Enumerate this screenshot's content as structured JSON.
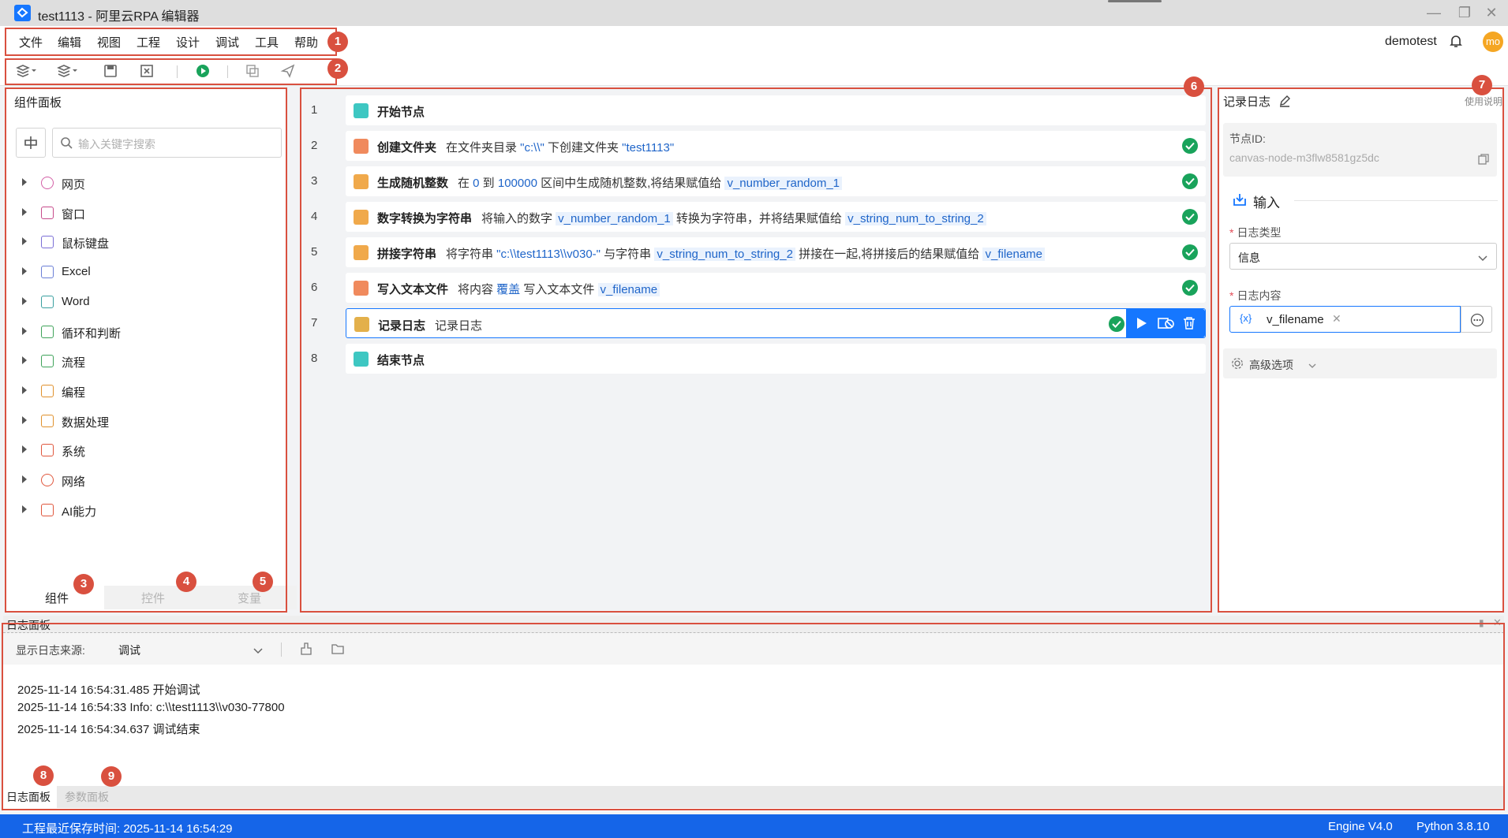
{
  "window": {
    "title": "test1113 - 阿里云RPA 编辑器"
  },
  "menu": {
    "items": [
      "文件",
      "编辑",
      "视图",
      "工程",
      "设计",
      "调试",
      "工具",
      "帮助"
    ],
    "user": "demotest",
    "avatar_text": "mo"
  },
  "badges": [
    "1",
    "2",
    "3",
    "4",
    "5",
    "6",
    "7",
    "8",
    "9"
  ],
  "left_panel": {
    "title": "组件面板",
    "search_placeholder": "输入关键字搜索",
    "tree": [
      {
        "label": "网页",
        "icon": "globe-icon",
        "color": "#d35fa6"
      },
      {
        "label": "窗口",
        "icon": "window-icon",
        "color": "#c74b8b"
      },
      {
        "label": "鼠标键盘",
        "icon": "mouse-icon",
        "color": "#7b6fd6"
      },
      {
        "label": "Excel",
        "icon": "excel-icon",
        "color": "#6b7fd6"
      },
      {
        "label": "Word",
        "icon": "word-icon",
        "color": "#3aa0a0"
      },
      {
        "label": "循环和判断",
        "icon": "loop-icon",
        "color": "#3fa35a"
      },
      {
        "label": "流程",
        "icon": "flow-icon",
        "color": "#3fa35a"
      },
      {
        "label": "编程",
        "icon": "code-icon",
        "color": "#e0912d"
      },
      {
        "label": "数据处理",
        "icon": "data-icon",
        "color": "#e0912d"
      },
      {
        "label": "系统",
        "icon": "monitor-icon",
        "color": "#e0573d"
      },
      {
        "label": "网络",
        "icon": "wifi-icon",
        "color": "#e0573d"
      },
      {
        "label": "AI能力",
        "icon": "ai-icon",
        "color": "#e0573d"
      }
    ],
    "tabs": [
      "组件",
      "控件",
      "变量"
    ]
  },
  "canvas": {
    "nodes": [
      {
        "no": "1",
        "title": "开始节点",
        "icon_color": "#3ec7c2",
        "parts": []
      },
      {
        "no": "2",
        "title": "创建文件夹",
        "icon_color": "#f08a5d",
        "parts": [
          [
            "t",
            "在文件夹目录 "
          ],
          [
            "s",
            "\"c:\\\\\""
          ],
          [
            "t",
            " 下创建文件夹 "
          ],
          [
            "s",
            "\"test1113\""
          ]
        ],
        "check": true
      },
      {
        "no": "3",
        "title": "生成随机整数",
        "icon_color": "#f0a94b",
        "parts": [
          [
            "t",
            "在 "
          ],
          [
            "s",
            "0"
          ],
          [
            "t",
            " 到 "
          ],
          [
            "s",
            "100000"
          ],
          [
            "t",
            " 区间中生成随机整数,将结果赋值给 "
          ],
          [
            "v",
            "v_number_random_1"
          ]
        ],
        "check": true
      },
      {
        "no": "4",
        "title": "数字转换为字符串",
        "icon_color": "#f0a94b",
        "parts": [
          [
            "t",
            "将输入的数字 "
          ],
          [
            "v",
            "v_number_random_1"
          ],
          [
            "t",
            " 转换为字符串，并将结果赋值给 "
          ],
          [
            "v",
            "v_string_num_to_string_2"
          ]
        ],
        "check": true
      },
      {
        "no": "5",
        "title": "拼接字符串",
        "icon_color": "#f0a94b",
        "parts": [
          [
            "t",
            "将字符串 "
          ],
          [
            "s",
            "\"c:\\\\test1113\\\\v030-\""
          ],
          [
            "t",
            " 与字符串 "
          ],
          [
            "v",
            "v_string_num_to_string_2"
          ],
          [
            "t",
            " 拼接在一起,将拼接后的结果赋值给 "
          ],
          [
            "v",
            "v_filename"
          ]
        ],
        "check": true
      },
      {
        "no": "6",
        "title": "写入文本文件",
        "icon_color": "#f08a5d",
        "parts": [
          [
            "t",
            "将内容 "
          ],
          [
            "s",
            "覆盖"
          ],
          [
            "t",
            " 写入文本文件 "
          ],
          [
            "v",
            "v_filename"
          ]
        ],
        "check": true
      },
      {
        "no": "7",
        "title": "记录日志",
        "icon_color": "#e3b04b",
        "parts": [
          [
            "t",
            "记录日志"
          ]
        ],
        "check": true,
        "selected": true
      },
      {
        "no": "8",
        "title": "结束节点",
        "icon_color": "#3ec7c2",
        "parts": []
      }
    ]
  },
  "right_panel": {
    "title": "记录日志",
    "help": "使用说明",
    "node_id_label": "节点ID:",
    "node_id": "canvas-node-m3flw8581gz5dc",
    "section": "输入",
    "log_type_label": "日志类型",
    "log_type_value": "信息",
    "log_content_label": "日志内容",
    "log_content_var": "v_filename",
    "advanced": "高级选项"
  },
  "log_panel": {
    "title": "日志面板",
    "source_label": "显示日志来源:",
    "source_value": "调试",
    "lines": [
      "2025-11-14 16:54:31.485 开始调试",
      "2025-11-14 16:54:33 Info: c:\\\\test1113\\\\v030-77800",
      "2025-11-14 16:54:34.637 调试结束"
    ],
    "tabs": [
      "日志面板",
      "参数面板"
    ]
  },
  "status": {
    "saved": "工程最近保存时间:  2025-11-14 16:54:29",
    "engine": "Engine V4.0",
    "python": "Python 3.8.10"
  },
  "colors": {
    "accent": "#1677ff",
    "callout": "#d9503f",
    "status_bar": "#1565e8"
  }
}
